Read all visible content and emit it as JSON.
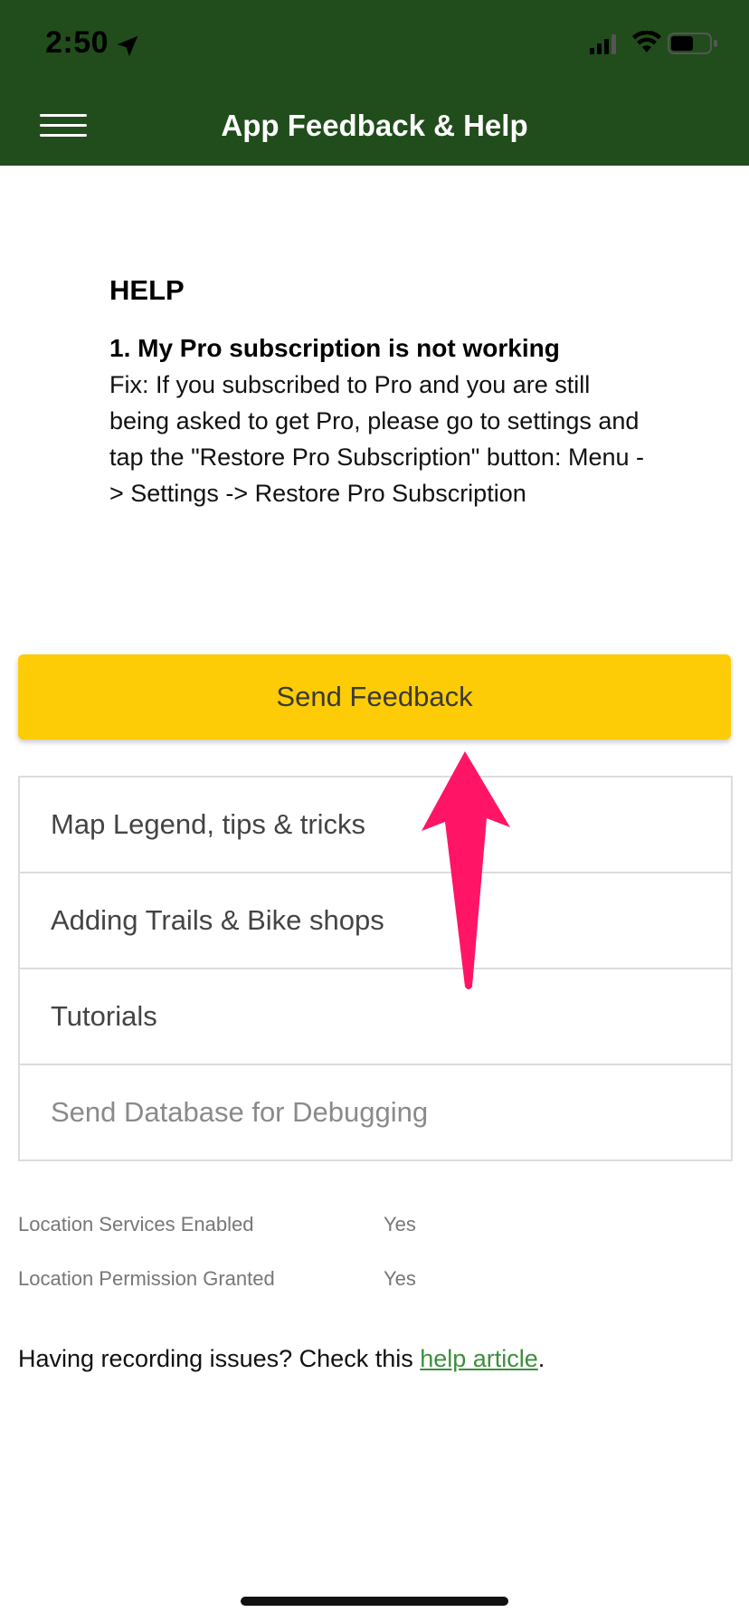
{
  "status_bar": {
    "time": "2:50"
  },
  "header": {
    "title": "App Feedback & Help"
  },
  "help": {
    "heading": "HELP",
    "question": "1. My Pro subscription is not working",
    "answer": "Fix: If you subscribed to Pro and you are still being asked to get Pro, please go to settings and tap the \"Restore Pro Subscription\" button: Menu -> Settings -> Restore Pro Subscription"
  },
  "feedback_button": {
    "label": "Send Feedback"
  },
  "menu_items": [
    {
      "label": "Map Legend, tips & tricks"
    },
    {
      "label": "Adding Trails & Bike shops"
    },
    {
      "label": "Tutorials"
    },
    {
      "label": "Send Database for Debugging"
    }
  ],
  "status_info": [
    {
      "label": "Location Services Enabled",
      "value": "Yes"
    },
    {
      "label": "Location Permission Granted",
      "value": "Yes"
    }
  ],
  "recording_note": {
    "text": "Having recording issues? Check this ",
    "link_text": "help article",
    "suffix": "."
  },
  "colors": {
    "header": "#214d1c",
    "button": "#fdcc07",
    "link": "#3e8e3e",
    "arrow": "#ff1466"
  }
}
